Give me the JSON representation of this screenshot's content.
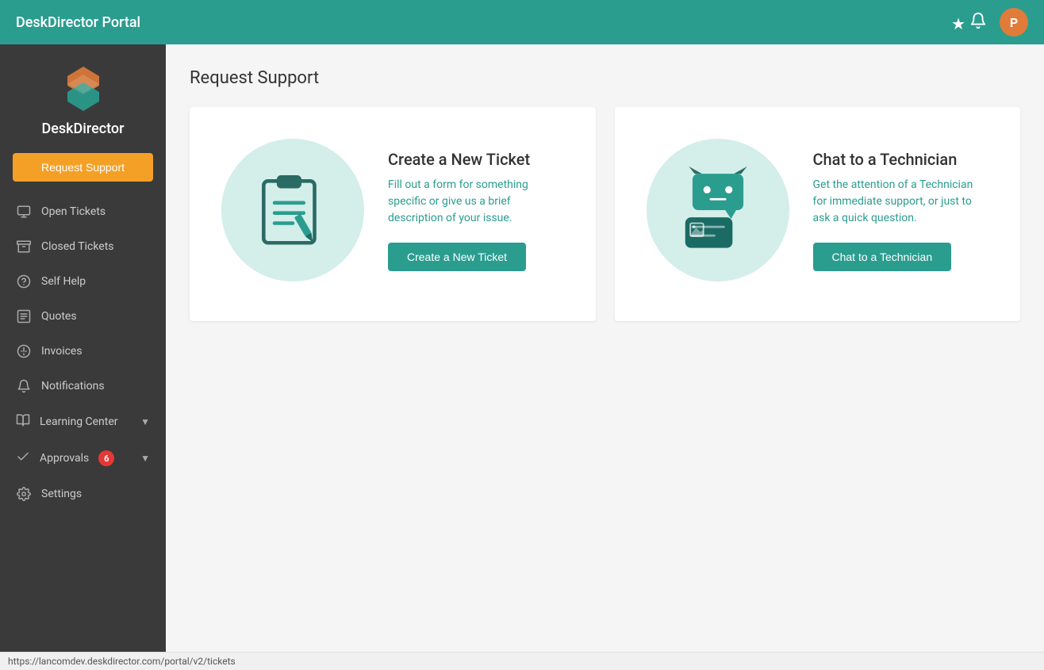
{
  "topbar": {
    "title": "DeskDirector Portal",
    "avatar_letter": "P"
  },
  "sidebar": {
    "logo_alt": "DeskDirector",
    "logo_text": "DeskDirector",
    "request_support_label": "Request Support",
    "items": [
      {
        "id": "open-tickets",
        "label": "Open Tickets",
        "icon": "ticket"
      },
      {
        "id": "closed-tickets",
        "label": "Closed Tickets",
        "icon": "archive"
      },
      {
        "id": "self-help",
        "label": "Self Help",
        "icon": "help"
      },
      {
        "id": "quotes",
        "label": "Quotes",
        "icon": "quotes"
      },
      {
        "id": "invoices",
        "label": "Invoices",
        "icon": "dollar"
      },
      {
        "id": "notifications",
        "label": "Notifications",
        "icon": "bell"
      }
    ],
    "sections": [
      {
        "id": "learning-center",
        "label": "Learning Center",
        "has_chevron": true
      },
      {
        "id": "approvals",
        "label": "Approvals",
        "badge": "6",
        "has_chevron": true
      },
      {
        "id": "settings",
        "label": "Settings",
        "icon": "gear"
      }
    ]
  },
  "main": {
    "page_title": "Request Support",
    "cards": [
      {
        "id": "new-ticket",
        "title": "Create a New Ticket",
        "description": "Fill out a form for something specific or give us a brief description of your issue.",
        "button_label": "Create a New Ticket"
      },
      {
        "id": "chat-technician",
        "title": "Chat to a Technician",
        "description": "Get the attention of a Technician for immediate support, or just to ask a quick question.",
        "button_label": "Chat to a Technician"
      }
    ]
  },
  "statusbar": {
    "url": "https://lancomdev.deskdirector.com/portal/v2/tickets"
  }
}
